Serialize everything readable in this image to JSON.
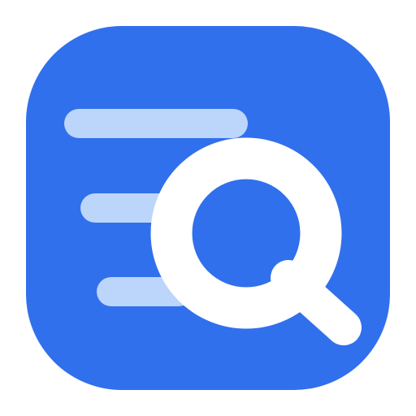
{
  "icon": {
    "name": "search-list-icon",
    "colors": {
      "background": "#ffffff",
      "tile": "#3170ec",
      "line": "#bcd5fb",
      "lens": "#ffffff"
    }
  }
}
